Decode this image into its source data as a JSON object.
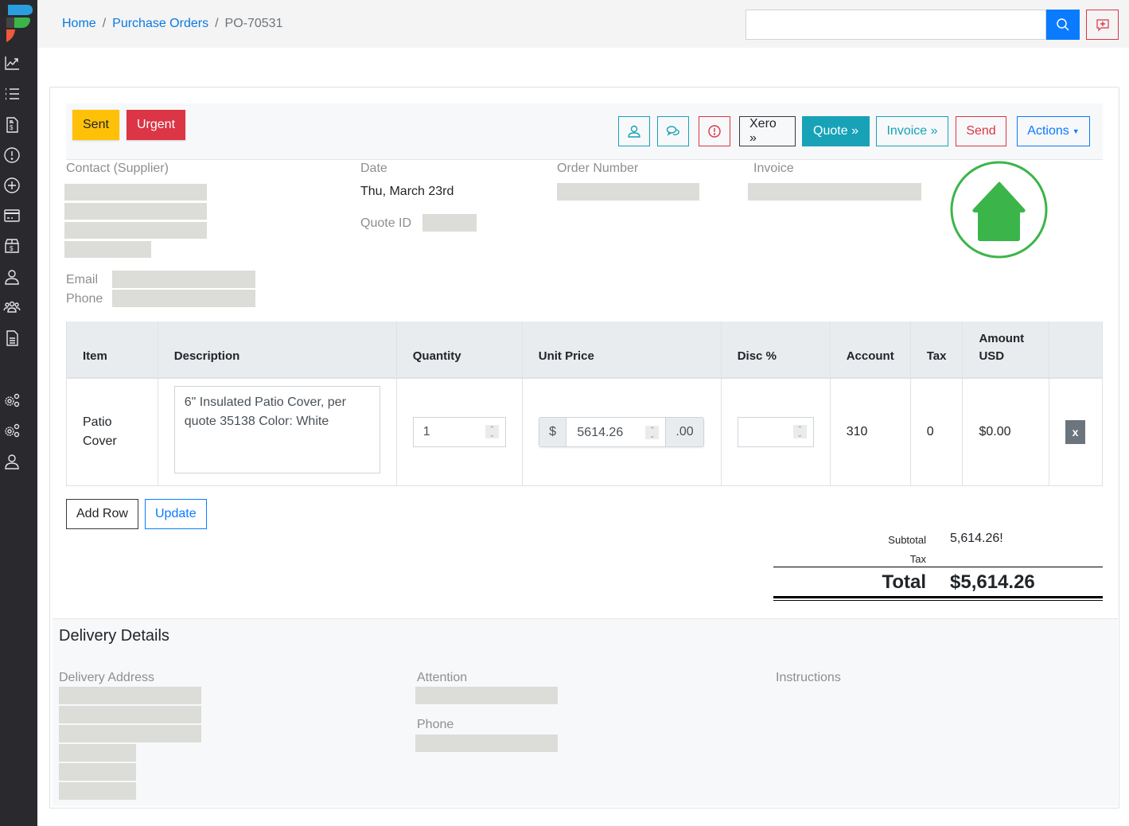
{
  "breadcrumb": {
    "home": "Home",
    "section": "Purchase Orders",
    "current": "PO-70531",
    "separator": "/"
  },
  "search": {
    "value": "",
    "placeholder": ""
  },
  "sidebar": {
    "items": [
      {
        "icon": "chart-trend-icon",
        "label": "Dashboard"
      },
      {
        "icon": "list-icon",
        "label": "List"
      },
      {
        "icon": "invoice-icon",
        "label": "Invoices"
      },
      {
        "icon": "alert-icon",
        "label": "Alerts"
      },
      {
        "icon": "add-circle-icon",
        "label": "Add"
      },
      {
        "icon": "credit-card-icon",
        "label": "Payments"
      },
      {
        "icon": "box-dollar-icon",
        "label": "Purchase Orders"
      },
      {
        "icon": "user-icon",
        "label": "Contacts"
      },
      {
        "icon": "users-icon",
        "label": "Team"
      },
      {
        "icon": "document-icon",
        "label": "Documents"
      },
      {
        "icon": "settings-gears-icon",
        "label": "Settings"
      },
      {
        "icon": "settings-gears-icon",
        "label": "Admin Settings"
      },
      {
        "icon": "user-icon",
        "label": "Profile"
      }
    ]
  },
  "status": {
    "sent": "Sent",
    "urgent": "Urgent"
  },
  "toolbar": {
    "xero": "Xero »",
    "quote": "Quote »",
    "invoice": "Invoice »",
    "send": "Send",
    "actions": "Actions"
  },
  "colors": {
    "primary": "#0a7bff",
    "info": "#17a2b8",
    "danger": "#dc3545",
    "warning": "#ffc107",
    "success": "#3bb54a"
  },
  "details": {
    "contact_label": "Contact (Supplier)",
    "date_label": "Date",
    "date_value": "Thu, March 23rd",
    "quote_id_label": "Quote ID",
    "order_number_label": "Order Number",
    "invoice_label": "Invoice",
    "email_label": "Email",
    "phone_label": "Phone"
  },
  "table": {
    "headers": [
      "Item",
      "Description",
      "Quantity",
      "Unit Price",
      "Disc %",
      "Account",
      "Tax",
      "Amount USD",
      ""
    ],
    "rows": [
      {
        "item": "Patio Cover",
        "description": "6\" Insulated Patio Cover, per quote 35138 Color: White",
        "quantity": "1",
        "currency": "$",
        "unit_price": "5614.26",
        "cents": ".00",
        "disc": "",
        "account": "310",
        "tax": "0",
        "amount": "$0.00",
        "remove": "x"
      }
    ]
  },
  "actions": {
    "add_row": "Add Row",
    "update": "Update"
  },
  "totals": {
    "subtotal_label": "Subtotal",
    "subtotal_value": "5,614.26!",
    "tax_label": "Tax",
    "tax_value": "",
    "total_label": "Total",
    "total_value": "$5,614.26"
  },
  "delivery": {
    "title": "Delivery Details",
    "address_label": "Delivery Address",
    "attention_label": "Attention",
    "phone_label": "Phone",
    "instructions_label": "Instructions"
  }
}
